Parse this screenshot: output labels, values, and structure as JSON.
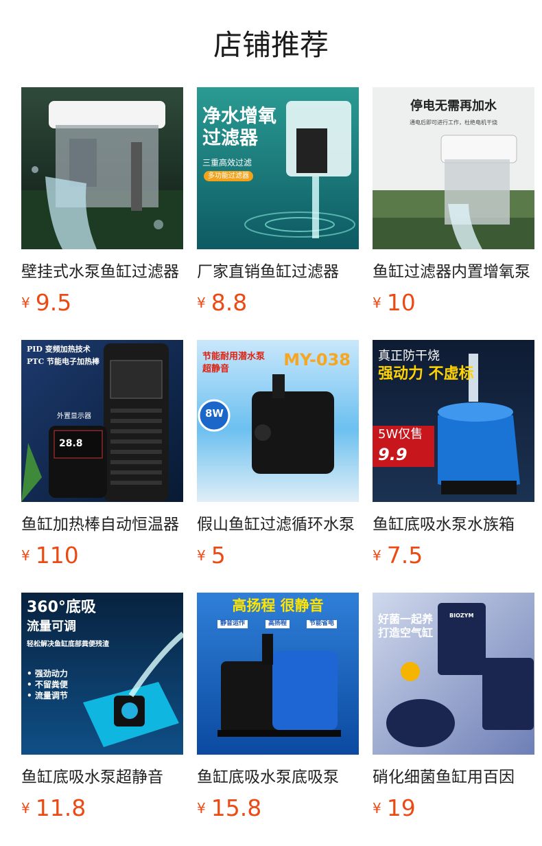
{
  "page": {
    "title": "店铺推荐"
  },
  "products": [
    {
      "name": "壁挂式水泵鱼缸过滤器",
      "currency": "¥",
      "price": "9.5"
    },
    {
      "name": "厂家直销鱼缸过滤器",
      "currency": "¥",
      "price": "8.8",
      "image_text": [
        "净水增氧",
        "过滤器",
        "三重高效过滤",
        "多功能过滤器"
      ]
    },
    {
      "name": "鱼缸过滤器内置增氧泵",
      "currency": "¥",
      "price": "10",
      "image_text": [
        "停电无需再加水",
        "通电后即可进行工作，杜绝电机干烧"
      ]
    },
    {
      "name": "鱼缸加热棒自动恒温器",
      "currency": "¥",
      "price": "110",
      "image_text": [
        "PID 变频加热技术",
        "PTC 节能电子加热棒",
        "外置显示器",
        "28.8"
      ]
    },
    {
      "name": "假山鱼缸过滤循环水泵",
      "currency": "¥",
      "price": "5",
      "image_text": [
        "节能耐用潜水泵",
        "超静音",
        "MY-038",
        "8W"
      ]
    },
    {
      "name": "鱼缸底吸水泵水族箱",
      "currency": "¥",
      "price": "7.5",
      "image_text": [
        "真正防干烧",
        "强动力 不虚标",
        "5W仅售",
        "9.9"
      ]
    },
    {
      "name": "鱼缸底吸水泵超静音",
      "currency": "¥",
      "price": "11.8",
      "image_text": [
        "360°底吸",
        "流量可调",
        "轻松解决鱼缸底部粪便残渣",
        "• 强劲动力",
        "• 不留粪便",
        "• 流量调节"
      ]
    },
    {
      "name": "鱼缸底吸水泵底吸泵",
      "currency": "¥",
      "price": "15.8",
      "image_text": [
        "高扬程 很静音",
        "静音运作",
        "高扬程",
        "节能省电"
      ]
    },
    {
      "name": "硝化细菌鱼缸用百因",
      "currency": "¥",
      "price": "19",
      "image_text": [
        "好菌一起养",
        "打造空气缸",
        "BIOZYM"
      ]
    }
  ]
}
